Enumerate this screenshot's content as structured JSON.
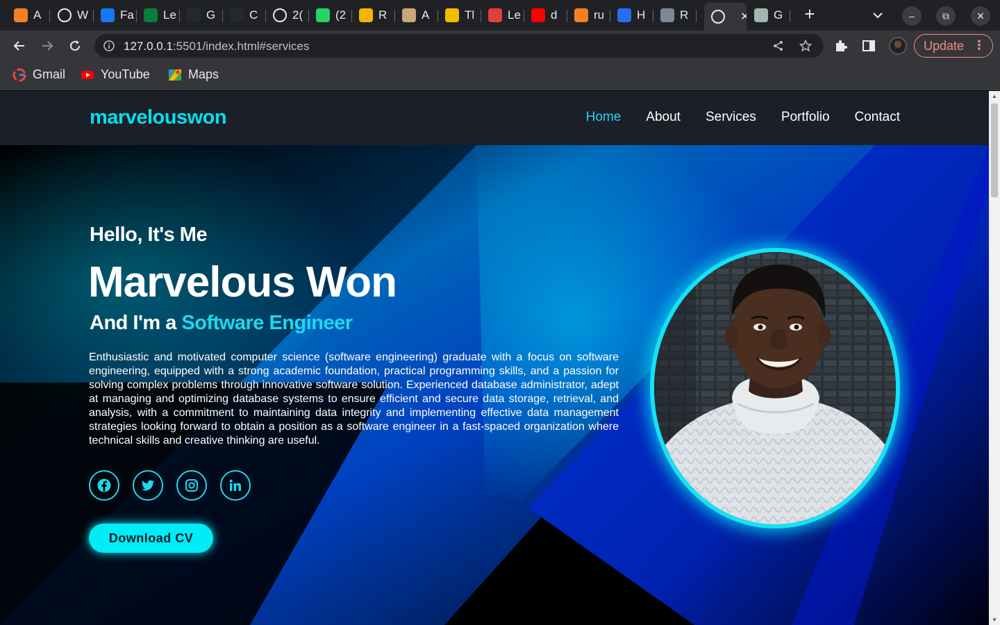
{
  "browser": {
    "tabs": [
      {
        "title": "A",
        "icon": "stack-icon",
        "color": "#f48024"
      },
      {
        "title": "W",
        "icon": "globe-icon",
        "color": "#e8eaed"
      },
      {
        "title": "Fa",
        "icon": "facebook-icon",
        "color": "#1877f2"
      },
      {
        "title": "Le",
        "icon": "ir-icon",
        "color": "#0a7d3a"
      },
      {
        "title": "G",
        "icon": "github-icon",
        "color": "#24292f"
      },
      {
        "title": "C",
        "icon": "github-icon",
        "color": "#24292f"
      },
      {
        "title": "2(",
        "icon": "globe-icon",
        "color": "#e8eaed"
      },
      {
        "title": "(2",
        "icon": "whatsapp-icon",
        "color": "#25d366"
      },
      {
        "title": "R",
        "icon": "e-icon",
        "color": "#f5b400"
      },
      {
        "title": "A",
        "icon": "gnu-icon",
        "color": "#c8a878"
      },
      {
        "title": "Tl",
        "icon": "mascot-icon",
        "color": "#f0c000"
      },
      {
        "title": "Le",
        "icon": "slash-icon",
        "color": "#e04040"
      },
      {
        "title": "d",
        "icon": "youtube-icon",
        "color": "#ff0000"
      },
      {
        "title": "ru",
        "icon": "stackoverflow-icon",
        "color": "#f48024"
      },
      {
        "title": "H",
        "icon": "loop-icon",
        "color": "#2a6cf0"
      },
      {
        "title": "R",
        "icon": "monitor-icon",
        "color": "#7a8a99"
      },
      {
        "title": "",
        "icon": "globe-icon",
        "color": "#e8eaed",
        "active": true
      },
      {
        "title": "G",
        "icon": "openai-icon",
        "color": "#a0b8b0"
      }
    ],
    "address": {
      "host": "127.0.0.1",
      "rest": ":5501/index.html#services"
    },
    "update_label": "Update",
    "bookmarks": [
      {
        "label": "Gmail",
        "icon": "google-icon"
      },
      {
        "label": "YouTube",
        "icon": "youtube-icon"
      },
      {
        "label": "Maps",
        "icon": "maps-icon"
      }
    ]
  },
  "site": {
    "logo": "marvelouswon",
    "nav": [
      {
        "label": "Home",
        "active": true
      },
      {
        "label": "About"
      },
      {
        "label": "Services"
      },
      {
        "label": "Portfolio"
      },
      {
        "label": "Contact"
      }
    ],
    "hero": {
      "greeting": "Hello, It's Me",
      "name": "Marvelous Won",
      "role_prefix": "And I'm a ",
      "role": "Software Engineer",
      "bio": "Enthusiastic and motivated computer science (software engineering) graduate with a focus on software engineering, equipped with a strong academic foundation, practical programming skills, and a passion for solving complex problems through innovative software solution. Experienced database administrator, adept at managing and optimizing database systems to ensure efficient and secure data storage, retrieval, and analysis, with a commitment to maintaining data integrity and implementing effective data management strategies looking forward to obtain a position as a software engineer in a fast-spaced organization where technical skills and creative thinking are useful.",
      "socials": [
        "facebook-icon",
        "twitter-icon",
        "instagram-icon",
        "linkedin-icon"
      ],
      "cta": "Download CV"
    },
    "colors": {
      "accent": "#1ed8f0",
      "header_bg": "#1b1f27",
      "button": "#00ecf6"
    }
  }
}
